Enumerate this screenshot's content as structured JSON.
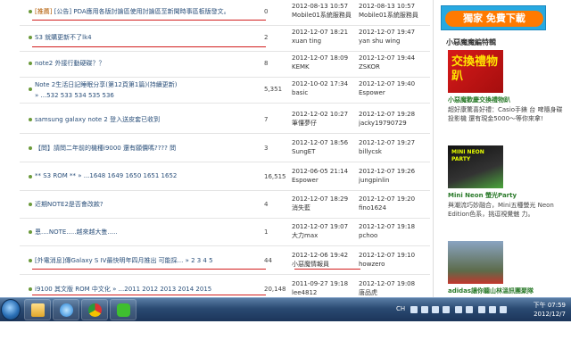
{
  "forum": {
    "rows": [
      {
        "tag": "[推薦]",
        "title": " [公告] PDA應用各版討論區使用討論區至新聞時事區板版發文。",
        "pages": "",
        "replies": "0",
        "c1_date": "2012-08-13 10:57",
        "c1_user": "Mobile01系統服務員",
        "c2_date": "2012-08-13 10:57",
        "c2_user": "Mobile01系統服務員",
        "highlight": true
      },
      {
        "tag": "",
        "title": "S3 就購更新不了lk4",
        "pages": "",
        "replies": "2",
        "c1_date": "2012-12-07 18:21",
        "c1_user": "xuan ting",
        "c2_date": "2012-12-07 19:47",
        "c2_user": "yan shu wing"
      },
      {
        "tag": "",
        "title": "note2 外接行動硬碟？？",
        "pages": "",
        "replies": "8",
        "c1_date": "2012-12-07 18:09",
        "c1_user": "KEMK",
        "c2_date": "2012-12-07 19:44",
        "c2_user": "ZSKOR"
      },
      {
        "tag": "",
        "title": "Note 2生活日記睡眠分享(第12頁第1篇)(持續更新)",
        "pages": "» ...532 533 534 535 536",
        "replies": "5,351",
        "c1_date": "2012-10-02 17:34",
        "c1_user": "basic",
        "c2_date": "2012-12-07 19:40",
        "c2_user": "Espower"
      },
      {
        "tag": "",
        "title": "samsung galaxy note 2 登入送皮套已收到",
        "pages": "",
        "replies": "7",
        "c1_date": "2012-12-02 10:27",
        "c1_user": "筆懂夢仔",
        "c2_date": "2012-12-07 19:28",
        "c2_user": "jacky19790729"
      },
      {
        "tag": "",
        "title": "【問】請問二年前的機種i9000 還有願價嗎???? 問",
        "pages": "",
        "replies": "3",
        "c1_date": "2012-12-07 18:56",
        "c1_user": "SungET",
        "c2_date": "2012-12-07 19:27",
        "c2_user": "billycsk"
      },
      {
        "tag": "",
        "title": "** S3 ROM ** » ...1648 1649 1650 1651 1652",
        "pages": "",
        "replies": "16,515",
        "c1_date": "2012-06-05 21:14",
        "c1_user": "Espower",
        "c2_date": "2012-12-07 19:26",
        "c2_user": "jungpinlin"
      },
      {
        "tag": "",
        "title": "近期NOTE2是否會改款?",
        "pages": "",
        "replies": "4",
        "c1_date": "2012-12-07 18:29",
        "c1_user": "消失藍",
        "c2_date": "2012-12-07 19:20",
        "c2_user": "fino1624"
      },
      {
        "tag": "",
        "title": "恩....NOTE.....越來越大隻.....",
        "pages": "",
        "replies": "1",
        "c1_date": "2012-12-07 19:07",
        "c1_user": "大力max",
        "c2_date": "2012-12-07 19:18",
        "c2_user": "pchoo"
      },
      {
        "tag": "",
        "title": "[外電消息]傳Galaxy S IV最快明年四月推出 可能採... » 2 3 4 5",
        "pages": "",
        "replies": "44",
        "c1_date": "2012-12-06 19:42",
        "c1_user": "小惡魔情報員",
        "c2_date": "2012-12-07 19:10",
        "c2_user": "howzero",
        "highlight": true
      },
      {
        "tag": "",
        "title": "i9100 其文版 ROM 中文化 » ...2011 2012 2013 2014 2015",
        "pages": "",
        "replies": "20,148",
        "c1_date": "2011-09-27 19:18",
        "c1_user": "lee4812",
        "c2_date": "2012-12-07 19:08",
        "c2_user": "唐品虎"
      }
    ]
  },
  "sidebar": {
    "banner": "獨家 免費下載",
    "section_title": "小惡魔魔編特輯",
    "promo1_img_text": "交換禮物趴",
    "promo1_title": "小惡魔歡慶交換禮物趴",
    "promo1_desc": "超好康驚喜好禮：Casio手錶 台 啤隨身碟 投影機 還有現金5000～等你來拿!",
    "promo2_img_text": "MINI NEON PARTY",
    "promo2_title": "Mini Neon 螢光Party",
    "promo2_desc": "與潮流巧妙融合，Mini五種螢光 Neon Edition色系，挑逗視覺魅 力。",
    "promo3_title": "adidas讓你聽山林溫訊團聚隊"
  },
  "taskbar": {
    "lang": "CH",
    "time": "下午 07:59",
    "date": "2012/12/7"
  },
  "colors": {
    "link": "#2a4f7a",
    "accent_red": "#d21e1e",
    "taskbar": "#2a4a72"
  }
}
